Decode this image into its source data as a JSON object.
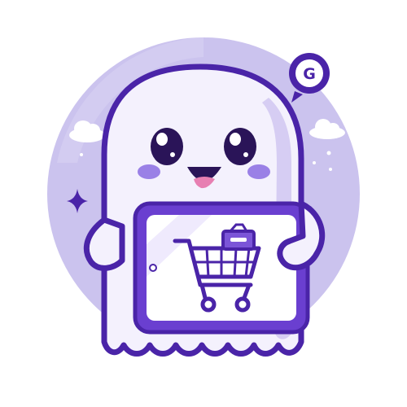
{
  "badge": {
    "letter": "G"
  },
  "colors": {
    "background": "#ffffff",
    "circle": "#cbc3ee",
    "circle_light": "#ded8f5",
    "outline": "#4a24a8",
    "outline_dark": "#3b1c8c",
    "ghost_body": "#f4f1fd",
    "ghost_shade": "#d6cdf3",
    "blush": "#9a80e6",
    "tongue": "#e77fb2",
    "tablet_frame": "#6a3fd0",
    "tablet_screen": "#ffffff",
    "cart": "#4a24a8",
    "sparkle": "#4a24a8"
  },
  "icons": [
    "ghost-mascot",
    "shopping-cart-icon",
    "tablet-device",
    "g-badge-icon",
    "sparkle-icon",
    "cloud-icon"
  ]
}
